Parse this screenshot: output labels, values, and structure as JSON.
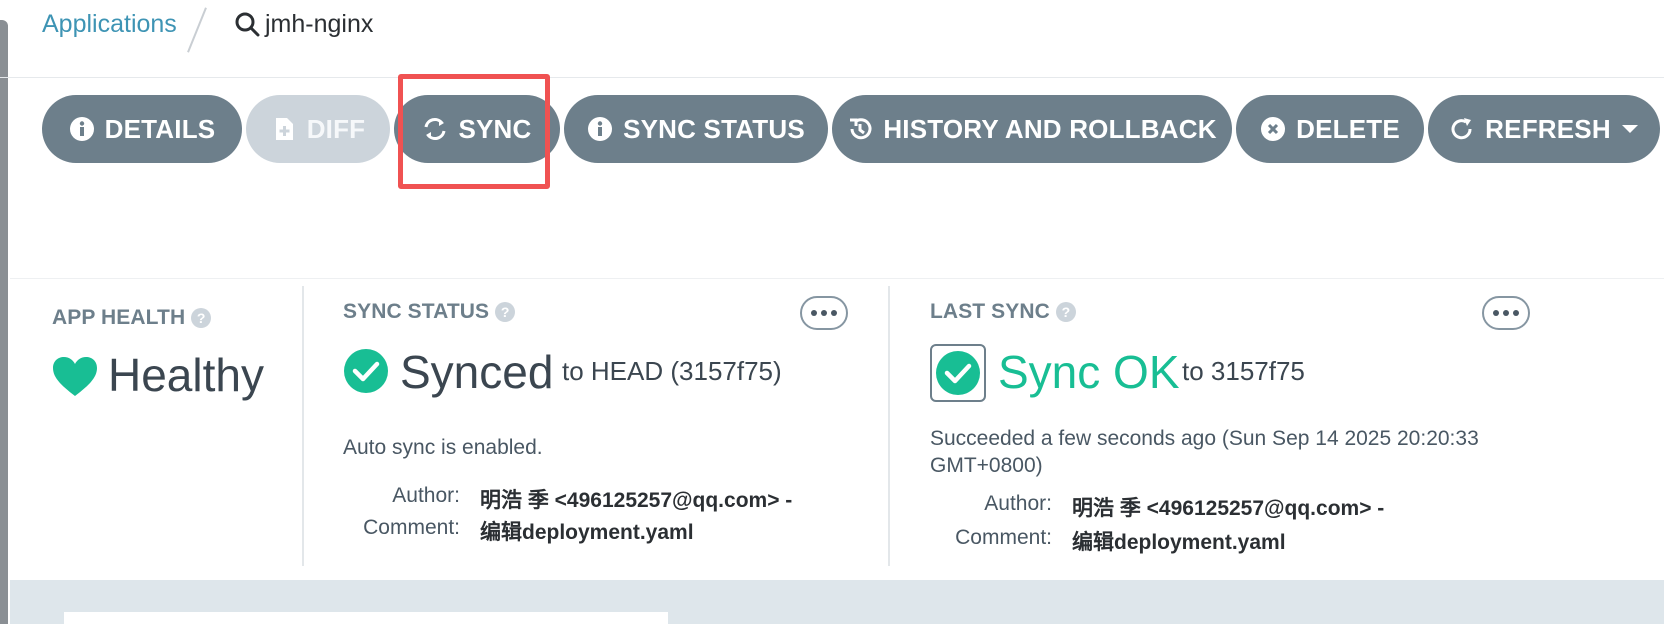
{
  "breadcrumb": {
    "applications_label": "Applications",
    "app_name": "jmh-nginx"
  },
  "toolbar": {
    "details_label": "DETAILS",
    "diff_label": "DIFF",
    "sync_label": "SYNC",
    "sync_status_label": "SYNC STATUS",
    "history_label": "HISTORY AND ROLLBACK",
    "delete_label": "DELETE",
    "refresh_label": "REFRESH"
  },
  "app_health": {
    "title": "APP HEALTH",
    "status": "Healthy",
    "color": "#18be94"
  },
  "sync_status": {
    "title": "SYNC STATUS",
    "status": "Synced",
    "target": "to HEAD (3157f75)",
    "auto_sync": "Auto sync is enabled.",
    "author_label": "Author:",
    "author_value": "明浩 季 <496125257@qq.com> -",
    "comment_label": "Comment:",
    "comment_value": "编辑deployment.yaml",
    "color": "#18be94"
  },
  "last_sync": {
    "title": "LAST SYNC",
    "status": "Sync OK",
    "target": "to 3157f75",
    "succeeded_line1": "Succeeded a few seconds ago (Sun Sep 14 2025 20:20:33",
    "succeeded_line2": "GMT+0800)",
    "author_label": "Author:",
    "author_value": "明浩 季 <496125257@qq.com> -",
    "comment_label": "Comment:",
    "comment_value": "编辑deployment.yaml",
    "color": "#18be94"
  },
  "help_glyph": "?",
  "colors": {
    "button_bg": "#6d7f8b",
    "button_disabled_bg": "#ccd4db",
    "link": "#3e94b4",
    "highlight": "#f05252"
  }
}
